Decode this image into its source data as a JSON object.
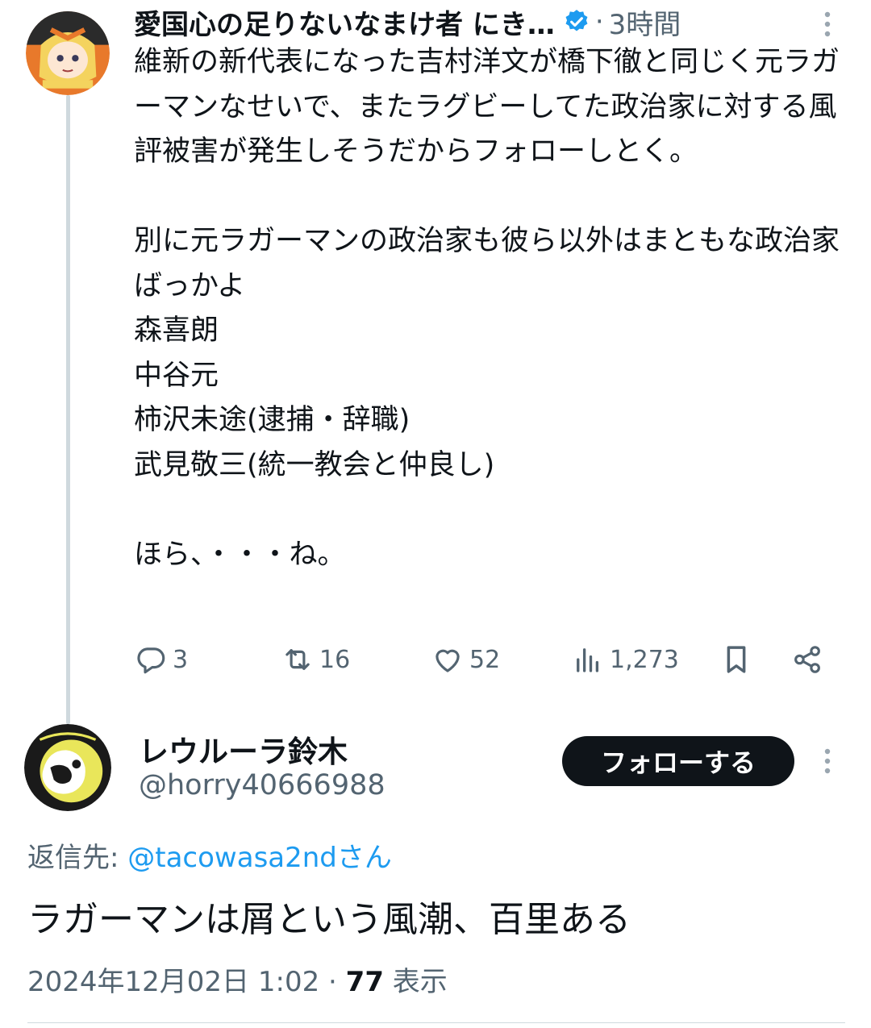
{
  "tweet": {
    "display_name": "愛国心の足りないなまけ者 にき…",
    "separator": "·",
    "time": "3時間",
    "body": "維新の新代表になった吉村洋文が橋下徹と同じく元ラガーマンなせいで、またラグビーしてた政治家に対する風評被害が発生しそうだからフォローしとく。\n\n別に元ラガーマンの政治家も彼ら以外はまともな政治家ばっかよ\n森喜朗\n中谷元\n柿沢未途(逮捕・辞職)\n武見敬三(統一教会と仲良し)\n\nほら、・・・ね。",
    "stats": {
      "replies": "3",
      "retweets": "16",
      "likes": "52",
      "views": "1,273"
    },
    "icons": [
      "verified-badge-icon",
      "more-icon",
      "reply-icon",
      "retweet-icon",
      "like-icon",
      "views-icon",
      "bookmark-icon",
      "share-icon"
    ]
  },
  "reply": {
    "display_name": "レウルーラ鈴木",
    "handle": "@horry40666988",
    "follow_label": "フォローする",
    "replying_prefix": "返信先: ",
    "replying_to": "@tacowasa2ndさん",
    "text": "ラガーマンは屑という風潮、百里ある",
    "date": "2024年12月02日 1:02",
    "meta_sep": " · ",
    "view_count": "77",
    "view_label": " 表示"
  },
  "colors": {
    "text": "#0f1419",
    "secondary": "#536471",
    "accent": "#1d9bf0",
    "line": "#cfd9de",
    "button": "#0f1419"
  }
}
